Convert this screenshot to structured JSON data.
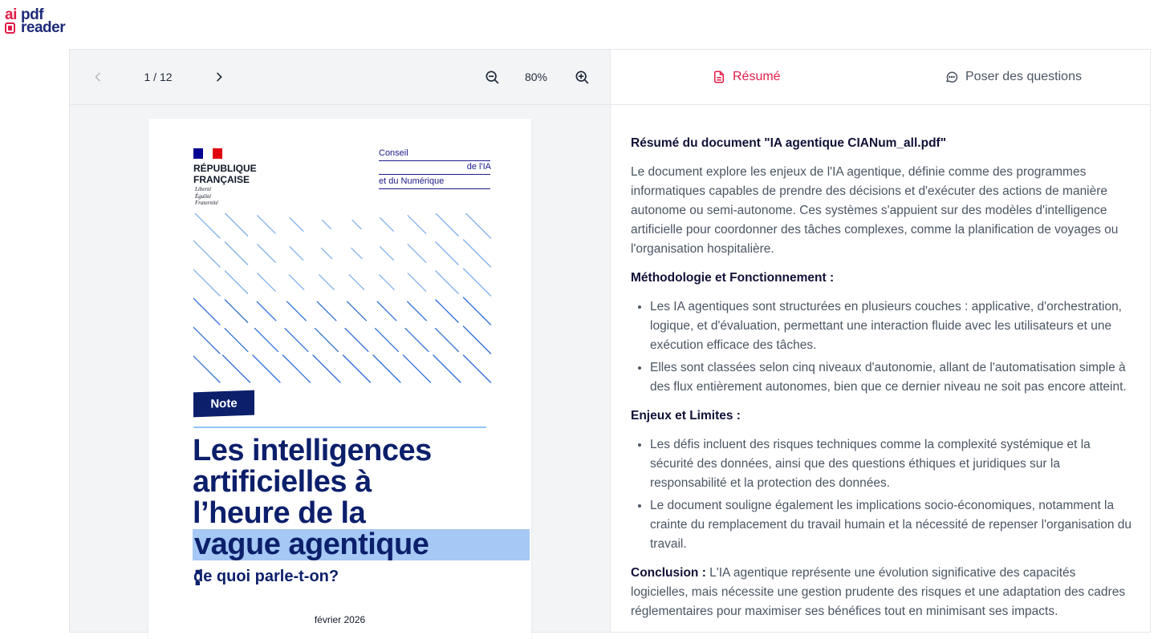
{
  "app": {
    "logo_ai": "ai",
    "logo_pdf": "pdf",
    "logo_reader": "reader",
    "brand_color": "#1e2a78",
    "accent_color": "#e11d48"
  },
  "viewer": {
    "page_indicator": "1 / 12",
    "zoom_level": "80%",
    "icons": {
      "prev": "chevron-left-icon",
      "next": "chevron-right-icon",
      "zoom_out": "zoom-out-icon",
      "zoom_in": "zoom-in-icon"
    }
  },
  "document": {
    "rf_line1": "RÉPUBLIQUE",
    "rf_line2": "FRANÇAISE",
    "motto1": "Liberté",
    "motto2": "Égalité",
    "motto3": "Fraternité",
    "conseil1": "Conseil",
    "conseil2": "de l'IA",
    "conseil3": "et du Numérique",
    "badge": "Note",
    "title1": "Les intelligences",
    "title2": "artificielles à",
    "title3": "l’heure de la",
    "title4_hl": "vague agentique",
    "title4_rest": " :",
    "subtitle": "de quoi parle-t-on?",
    "date": "février 2026"
  },
  "tabs": {
    "resume": "Résumé",
    "questions": "Poser des questions"
  },
  "summary": {
    "heading": "Résumé du document \"IA agentique CIANum_all.pdf\"",
    "intro": "Le document explore les enjeux de l'IA agentique, définie comme des programmes informatiques capables de prendre des décisions et d'exécuter des actions de manière autonome ou semi-autonome. Ces systèmes s'appuient sur des modèles d'intelligence artificielle pour coordonner des tâches complexes, comme la planification de voyages ou l'organisation hospitalière.",
    "section1_title": "Méthodologie et Fonctionnement :",
    "section1_items": [
      "Les IA agentiques sont structurées en plusieurs couches : applicative, d'orchestration, logique, et d'évaluation, permettant une interaction fluide avec les utilisateurs et une exécution efficace des tâches.",
      "Elles sont classées selon cinq niveaux d'autonomie, allant de l'automatisation simple à des flux entièrement autonomes, bien que ce dernier niveau ne soit pas encore atteint."
    ],
    "section2_title": "Enjeux et Limites :",
    "section2_items": [
      "Les défis incluent des risques techniques comme la complexité systémique et la sécurité des données, ainsi que des questions éthiques et juridiques sur la responsabilité et la protection des données.",
      "Le document souligne également les implications socio-économiques, notamment la crainte du remplacement du travail humain et la nécessité de repenser l'organisation du travail."
    ],
    "conclusion_label": "Conclusion :",
    "conclusion_text": " L'IA agentique représente une évolution significative des capacités logicielles, mais nécessite une gestion prudente des risques et une adaptation des cadres réglementaires pour maximiser ses bénéfices tout en minimisant ses impacts."
  }
}
